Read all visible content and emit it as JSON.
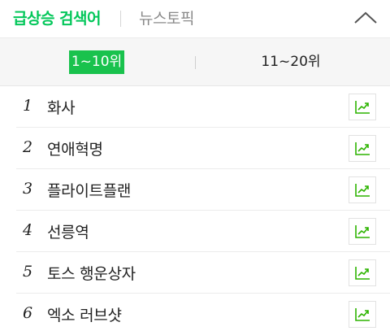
{
  "header": {
    "tab_main": "급상승 검색어",
    "tab_sub": "뉴스토픽",
    "collapse_icon": "chevron-up-icon"
  },
  "range": {
    "active_label": "1~10위",
    "inactive_label": "11~20위"
  },
  "keywords": [
    {
      "rank": "1",
      "label": "화사"
    },
    {
      "rank": "2",
      "label": "연애혁명"
    },
    {
      "rank": "3",
      "label": "플라이트플랜"
    },
    {
      "rank": "4",
      "label": "선릉역"
    },
    {
      "rank": "5",
      "label": "토스 행운상자"
    },
    {
      "rank": "6",
      "label": "엑소 러브샷"
    }
  ],
  "colors": {
    "accent": "#03c75a",
    "active_tab_bg": "#19c24d",
    "trend_icon": "#2db400"
  },
  "trend_icon": "trend-chart-icon"
}
